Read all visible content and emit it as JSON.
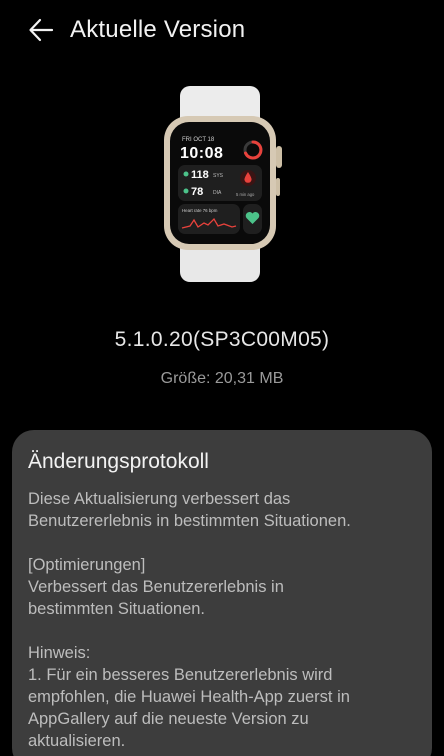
{
  "header": {
    "back_icon": "arrow-left-icon",
    "title": "Aktuelle Version"
  },
  "watch_face": {
    "date": "FRI OCT 18",
    "time": "10:08",
    "sys_value": "118",
    "sys_label": "SYS",
    "dia_value": "78",
    "dia_label": "DIA",
    "ago": "5 min ago",
    "heart_rate": "Heart rate 76 bpm"
  },
  "firmware": {
    "version": "5.1.0.20(SP3C00M05)",
    "size": "Größe: 20,31 MB"
  },
  "changelog": {
    "title": "Änderungsprotokoll",
    "intro": "Diese Aktualisierung verbessert das\nBenutzererlebnis in bestimmten Situationen.",
    "optimizations": "[Optimierungen]\nVerbessert das Benutzererlebnis in\nbestimmten Situationen.",
    "note": "Hinweis:\n1. Für ein besseres Benutzererlebnis wird\nempfohlen, die Huawei Health-App zuerst in\nAppGallery auf die neueste Version zu\naktualisieren."
  },
  "colors": {
    "background": "#000000",
    "card": "#3d3d3d",
    "accent_red": "#e8423c",
    "accent_green": "#4cc38a"
  }
}
